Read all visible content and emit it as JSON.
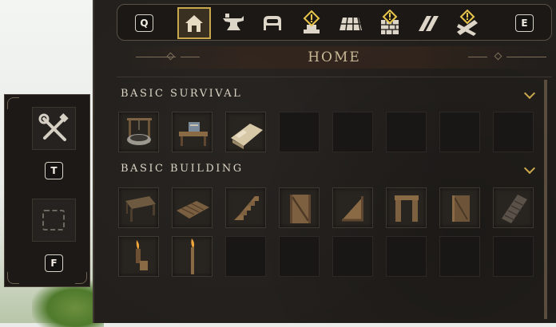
{
  "side_panel": {
    "slot_top_icon": "tools-icon",
    "key_top": "T",
    "slot_bottom_icon": "empty-slot-icon",
    "key_bottom": "F"
  },
  "category_bar": {
    "prev_key": "Q",
    "next_key": "E",
    "categories": [
      {
        "icon": "house-icon",
        "active": true,
        "alert": false
      },
      {
        "icon": "anvil-icon",
        "active": false,
        "alert": false
      },
      {
        "icon": "bed-icon",
        "active": false,
        "alert": false
      },
      {
        "icon": "beacon-icon",
        "active": false,
        "alert": true
      },
      {
        "icon": "floor-tiles-icon",
        "active": false,
        "alert": false
      },
      {
        "icon": "brick-wall-icon",
        "active": false,
        "alert": true
      },
      {
        "icon": "roof-icon",
        "active": false,
        "alert": false
      },
      {
        "icon": "planks-icon",
        "active": false,
        "alert": true
      }
    ]
  },
  "page_title": "HOME",
  "sections": [
    {
      "title": "BASIC SURVIVAL",
      "items": [
        "well-icon",
        "workbench-icon",
        "bedroll-icon",
        "",
        "",
        "",
        "",
        ""
      ]
    },
    {
      "title": "BASIC BUILDING",
      "items": [
        "wooden-table-icon",
        "wooden-floor-icon",
        "wooden-stairs-icon",
        "wooden-wall-icon",
        "wooden-triangle-wall-icon",
        "wooden-doorframe-icon",
        "wooden-door-icon",
        "wooden-roof-icon",
        "wall-torch-icon",
        "standing-torch-icon",
        "",
        "",
        "",
        "",
        "",
        ""
      ]
    }
  ],
  "colors": {
    "accent_gold": "#c9a84c",
    "panel_bg": "#221f1c",
    "title_text": "#c8b995",
    "header_text": "#ddd6c6"
  }
}
